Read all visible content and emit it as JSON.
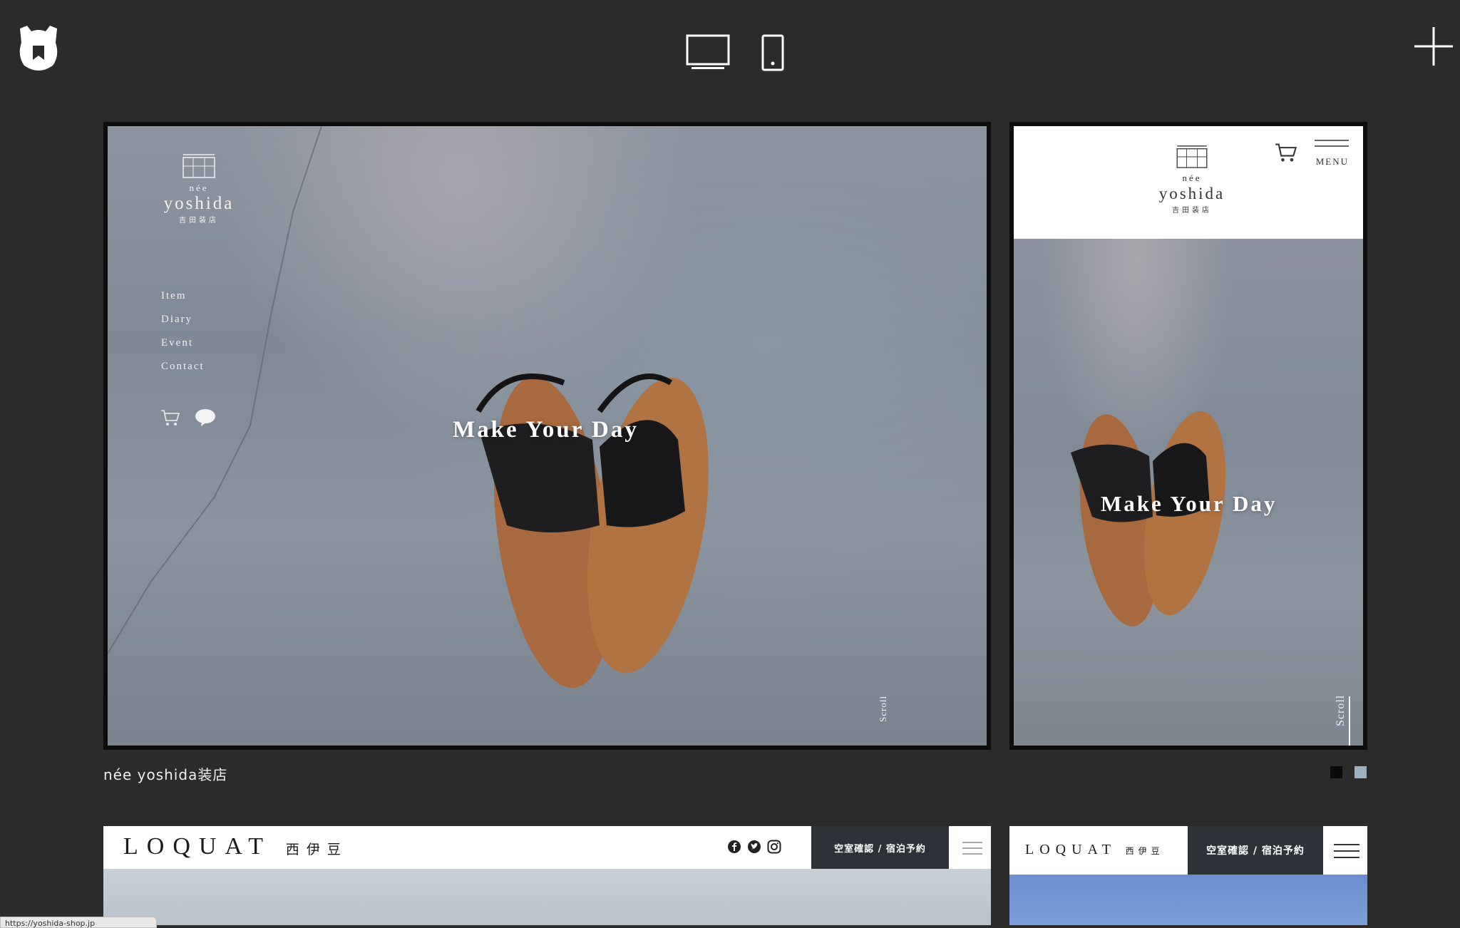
{
  "toolbar": {
    "logo_icon": "bear-logo-icon",
    "desktop_view_icon": "monitor-icon",
    "mobile_view_icon": "smartphone-icon",
    "add_icon": "plus-icon"
  },
  "site1": {
    "brand": {
      "nee": "née",
      "name": "yoshida",
      "sub": "吉田装店"
    },
    "nav": [
      "Item",
      "Diary",
      "Event",
      "Contact"
    ],
    "hero_title": "Make Your Day",
    "scroll": "Scroll",
    "menu_label": "MENU",
    "caption": "née yoshida装店",
    "pager_colors": [
      "#0a0a0a",
      "#9fb0c0"
    ]
  },
  "site2": {
    "logo": "LOQUAT",
    "logo_jp": "西伊豆",
    "cta": "空室確認 / 宿泊予約"
  },
  "status_url": "https://yoshida-shop.jp"
}
